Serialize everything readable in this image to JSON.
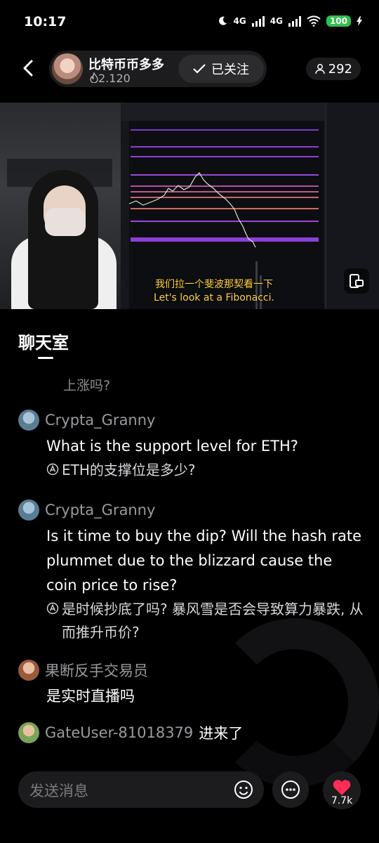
{
  "status_bar": {
    "time": "10:17",
    "network_1": "4G",
    "network_2": "4G",
    "battery": "100"
  },
  "header": {
    "streamer_name": "比特币币多多",
    "heat": "2.120",
    "follow_label": "已关注",
    "viewer_count": "292"
  },
  "video": {
    "subtitle_zh": "我们拉一个斐波那契看一下",
    "subtitle_en": "Let's look at a Fibonacci."
  },
  "chat": {
    "title": "聊天室",
    "faded_message": "上涨吗?",
    "messages": [
      {
        "user": "Crypta_Granny",
        "text": "What is the support level for ETH?",
        "translation": "ETH的支撑位是多少?"
      },
      {
        "user": "Crypta_Granny",
        "text": "Is it time to buy the dip?  Will the hash rate plummet due to the blizzard cause the coin price to rise?",
        "translation": "是时候抄底了吗? 暴风雪是否会导致算力暴跌, 从而推升币价?"
      },
      {
        "user": "果断反手交易员",
        "text": "是实时直播吗",
        "translation": ""
      }
    ],
    "join": {
      "user": "GateUser-81018379",
      "text": "进来了"
    }
  },
  "input_bar": {
    "placeholder": "发送消息"
  },
  "like": {
    "count": "7.7k"
  },
  "colors": {
    "background": "#000000",
    "surface": "#1c1c1e",
    "battery": "#2fbf4f",
    "subtitle": "#ffd23a",
    "like": "#ff2d55"
  }
}
